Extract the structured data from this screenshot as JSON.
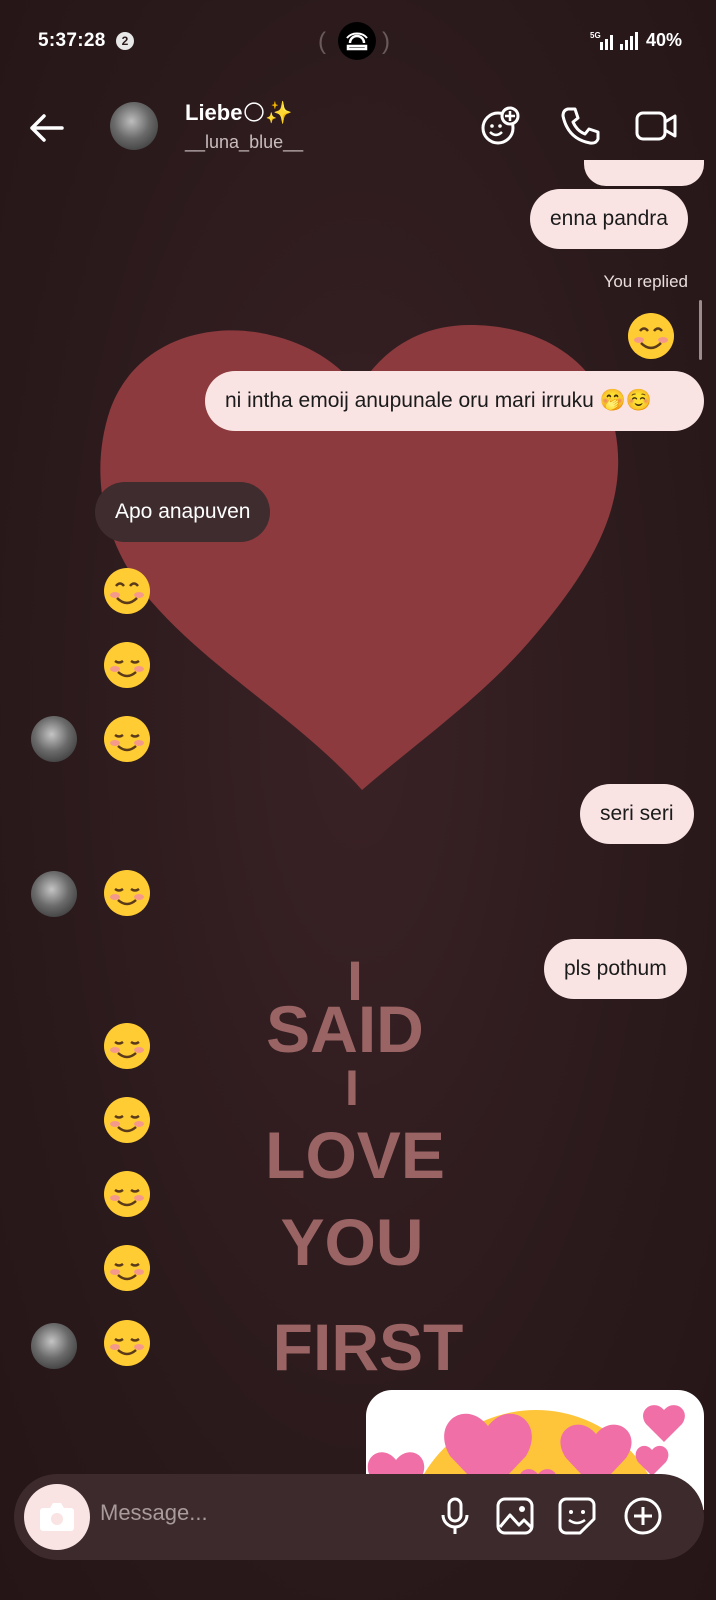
{
  "status_bar": {
    "time": "5:37:28",
    "notification_count": "2",
    "network": "5G",
    "battery": "40%"
  },
  "header": {
    "name": "Liebe🌕✨",
    "username": "__luna_blue__",
    "icons": [
      "add-effect-icon",
      "phone-icon",
      "video-icon"
    ]
  },
  "wallpaper": {
    "words": [
      "I",
      "SAID",
      "I",
      "LOVE",
      "YOU",
      "FIRST"
    ]
  },
  "messages": {
    "m1": "enna pandra",
    "replied_label": "You replied",
    "m2": "ni intha emoij anupunale oru mari irruku 🤭☺️",
    "m3": "Apo anapuven",
    "m4": "seri seri",
    "m5": "pls pothum"
  },
  "composer": {
    "placeholder": "Message...",
    "icons": [
      "camera-icon",
      "microphone-icon",
      "gallery-icon",
      "sticker-icon",
      "add-icon"
    ]
  },
  "colors": {
    "background": "#2b1a1c",
    "sent_bubble": "#f9e3e3",
    "received_bubble": "#3e2c2e",
    "heart": "#8c3a3d",
    "wallpaper_text": "#9a6464"
  }
}
